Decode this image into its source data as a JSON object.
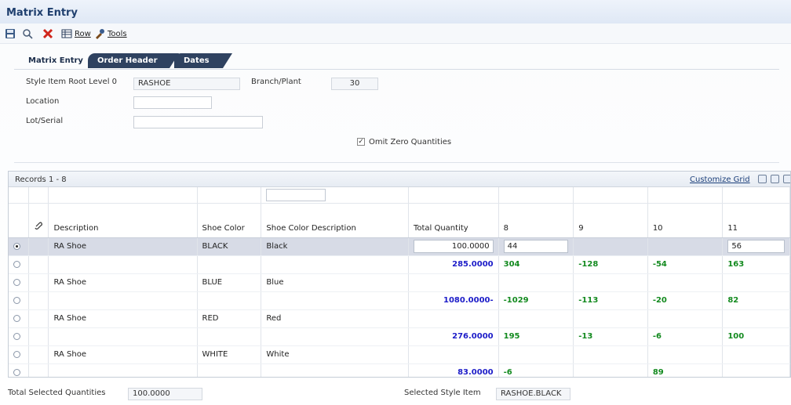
{
  "window": {
    "title": "Matrix Entry"
  },
  "toolbar": {
    "row_label": "Row",
    "tools_label": "Tools"
  },
  "tabs": [
    {
      "label": "Matrix Entry",
      "active": true
    },
    {
      "label": "Order Header",
      "active": false
    },
    {
      "label": "Dates",
      "active": false
    }
  ],
  "form": {
    "style_item_label": "Style Item Root Level 0",
    "style_item_value": "RASHOE",
    "branch_label": "Branch/Plant",
    "branch_value": "30",
    "location_label": "Location",
    "location_value": "",
    "lot_label": "Lot/Serial",
    "lot_value": "",
    "omit_zero_label": "Omit Zero Quantities",
    "omit_zero_checked": true
  },
  "grid": {
    "records_label": "Records 1 - 8",
    "customize_label": "Customize Grid",
    "columns": [
      "Description",
      "Shoe Color",
      "Shoe Color Description",
      "Total Quantity",
      "8",
      "9",
      "10",
      "11"
    ],
    "rows": [
      {
        "selected": true,
        "description": "RA Shoe",
        "color": "BLACK",
        "color_desc": "Black",
        "total": "100.0000",
        "c8": "44",
        "c9": "",
        "c10": "",
        "c11": "56",
        "kind": "input"
      },
      {
        "selected": false,
        "description": "",
        "color": "",
        "color_desc": "",
        "total": "285.0000",
        "c8": "304",
        "c9": "-128",
        "c10": "-54",
        "c11": "163",
        "kind": "sum"
      },
      {
        "selected": false,
        "description": "RA Shoe",
        "color": "BLUE",
        "color_desc": "Blue",
        "total": "",
        "c8": "",
        "c9": "",
        "c10": "",
        "c11": "",
        "kind": "item"
      },
      {
        "selected": false,
        "description": "",
        "color": "",
        "color_desc": "",
        "total": "1080.0000-",
        "c8": "-1029",
        "c9": "-113",
        "c10": "-20",
        "c11": "82",
        "kind": "sum"
      },
      {
        "selected": false,
        "description": "RA Shoe",
        "color": "RED",
        "color_desc": "Red",
        "total": "",
        "c8": "",
        "c9": "",
        "c10": "",
        "c11": "",
        "kind": "item"
      },
      {
        "selected": false,
        "description": "",
        "color": "",
        "color_desc": "",
        "total": "276.0000",
        "c8": "195",
        "c9": "-13",
        "c10": "-6",
        "c11": "100",
        "kind": "sum"
      },
      {
        "selected": false,
        "description": "RA Shoe",
        "color": "WHITE",
        "color_desc": "White",
        "total": "",
        "c8": "",
        "c9": "",
        "c10": "",
        "c11": "",
        "kind": "item"
      },
      {
        "selected": false,
        "description": "",
        "color": "",
        "color_desc": "",
        "total": "83.0000",
        "c8": "-6",
        "c9": "",
        "c10": "89",
        "c11": "",
        "kind": "sum"
      }
    ]
  },
  "footer": {
    "total_selected_label": "Total Selected Quantities",
    "total_selected_value": "100.0000",
    "selected_style_label": "Selected Style Item",
    "selected_style_value": "RASHOE.BLACK"
  },
  "colors": {
    "accent_blue": "#1c1cc8",
    "accent_green": "#138a1f",
    "tab_dark": "#2f4260",
    "title_blue": "#1f3f6e"
  }
}
